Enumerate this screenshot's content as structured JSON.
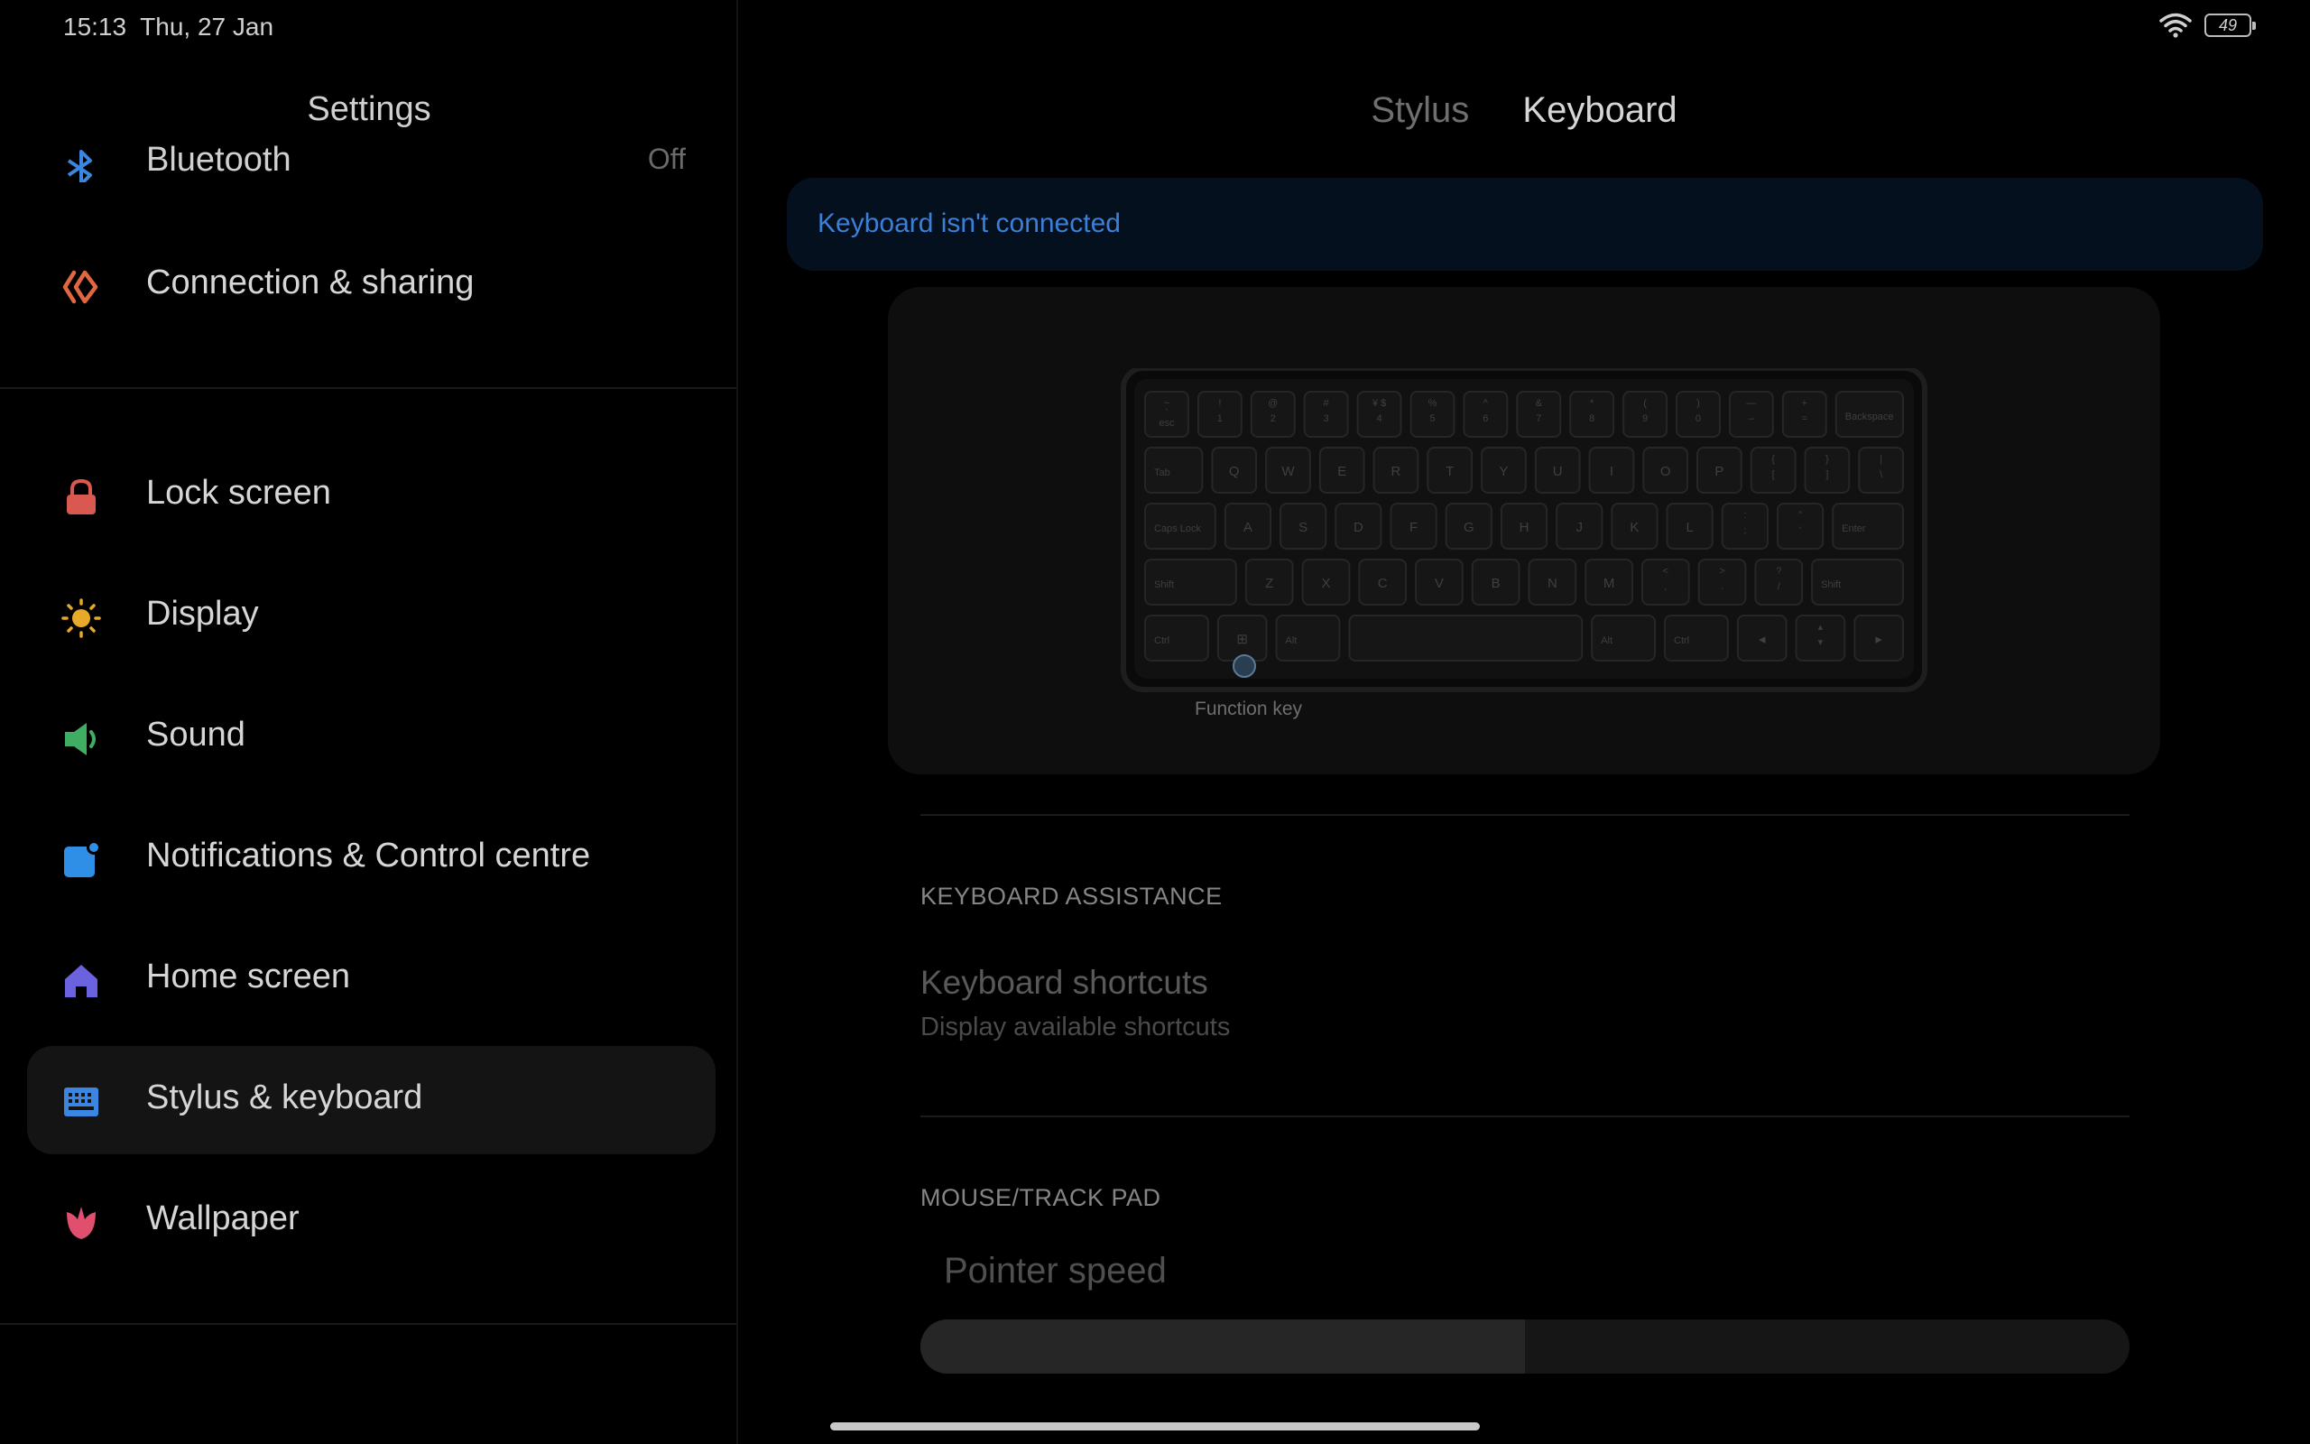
{
  "status_bar": {
    "time": "15:13",
    "date": "Thu, 27 Jan",
    "battery": "49",
    "icons": [
      "wifi-icon",
      "battery-icon"
    ]
  },
  "left_pane": {
    "title": "Settings",
    "bluetooth": {
      "label": "Bluetooth",
      "value": "Off",
      "icon": "bluetooth-icon",
      "color": "#3a86e0"
    },
    "items": [
      {
        "label": "Connection & sharing",
        "icon": "connection-sharing-icon",
        "color": "#e0673f",
        "selected": false
      },
      {
        "label": "Lock screen",
        "icon": "lock-icon",
        "color": "#d9584f",
        "selected": false
      },
      {
        "label": "Display",
        "icon": "sun-icon",
        "color": "#e6a92a",
        "selected": false
      },
      {
        "label": "Sound",
        "icon": "speaker-icon",
        "color": "#3fae63",
        "selected": false
      },
      {
        "label": "Notifications & Control centre",
        "icon": "notification-icon",
        "color": "#2f8fe6",
        "selected": false
      },
      {
        "label": "Home screen",
        "icon": "home-icon",
        "color": "#6b62e0",
        "selected": false
      },
      {
        "label": "Stylus & keyboard",
        "icon": "keyboard-icon",
        "color": "#3a86e0",
        "selected": true
      },
      {
        "label": "Wallpaper",
        "icon": "tulip-icon",
        "color": "#e04f6e",
        "selected": false
      }
    ]
  },
  "right_pane": {
    "tabs": [
      {
        "label": "Stylus",
        "active": false
      },
      {
        "label": "Keyboard",
        "active": true
      }
    ],
    "banner": "Keyboard isn't connected",
    "keyboard_image": {
      "function_key_label": "Function key",
      "rows": [
        [
          "~\n`\nesc",
          "!\n1",
          "@\n2",
          "#\n3",
          "¥ $\n4",
          "%\n5",
          "^\n6",
          "&\n7",
          "*\n8",
          "(\n9",
          ")\n0",
          "—\n–",
          "+\n=",
          "Backspace"
        ],
        [
          "Tab",
          "Q",
          "W",
          "E",
          "R",
          "T",
          "Y",
          "U",
          "I",
          "O",
          "P",
          "{\n[",
          "}\n]",
          "|\n\\"
        ],
        [
          "Caps Lock",
          "A",
          "S",
          "D",
          "F",
          "G",
          "H",
          "J",
          "K",
          "L",
          ":\n;",
          "\"\n'",
          "Enter"
        ],
        [
          "Shift",
          "Z",
          "X",
          "C",
          "V",
          "B",
          "N",
          "M",
          "<\n,",
          ">\n.",
          "?\n/",
          "Shift"
        ],
        [
          "Ctrl",
          "⊞",
          "Alt",
          "",
          "Alt",
          "Ctrl",
          "◂",
          "▴\n▾",
          "▸"
        ]
      ]
    },
    "keyboard_assistance": {
      "header": "KEYBOARD ASSISTANCE",
      "shortcuts_title": "Keyboard shortcuts",
      "shortcuts_subtitle": "Display available shortcuts"
    },
    "mouse": {
      "header": "MOUSE/TRACK PAD",
      "pointer_label": "Pointer speed",
      "pointer_speed_fraction": 0.5
    }
  }
}
